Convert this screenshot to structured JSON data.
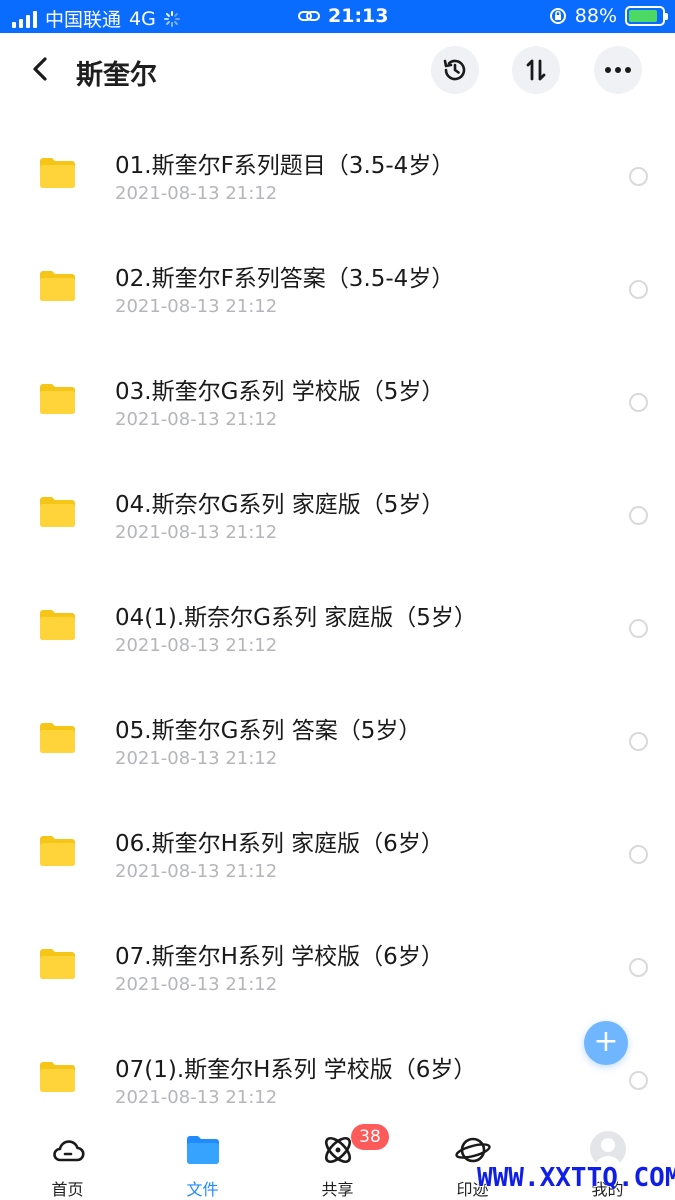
{
  "status_bar": {
    "carrier": "中国联通",
    "network": "4G",
    "time": "21:13",
    "battery": "88%",
    "battery_level": 0.88
  },
  "header": {
    "title": "斯奎尔",
    "icons": [
      "back-icon",
      "history-icon",
      "sort-icon",
      "more-icon"
    ]
  },
  "files": [
    {
      "name": "01.斯奎尔F系列题目（3.5-4岁）",
      "date": "2021-08-13 21:12"
    },
    {
      "name": "02.斯奎尔F系列答案（3.5-4岁）",
      "date": "2021-08-13 21:12"
    },
    {
      "name": "03.斯奎尔G系列 学校版（5岁）",
      "date": "2021-08-13 21:12"
    },
    {
      "name": "04.斯奈尔G系列 家庭版（5岁）",
      "date": "2021-08-13 21:12"
    },
    {
      "name": "04(1).斯奈尔G系列 家庭版（5岁）",
      "date": "2021-08-13 21:12"
    },
    {
      "name": "05.斯奎尔G系列 答案（5岁）",
      "date": "2021-08-13 21:12"
    },
    {
      "name": "06.斯奎尔H系列 家庭版（6岁）",
      "date": "2021-08-13 21:12"
    },
    {
      "name": "07.斯奎尔H系列 学校版（6岁）",
      "date": "2021-08-13 21:12"
    },
    {
      "name": "07(1).斯奎尔H系列 学校版（6岁）",
      "date": "2021-08-13 21:12"
    }
  ],
  "fab": {
    "label": "+"
  },
  "bottom_nav": {
    "items": [
      {
        "label": "首页",
        "icon": "cloud-icon",
        "active": false
      },
      {
        "label": "文件",
        "icon": "folder-icon",
        "active": true
      },
      {
        "label": "共享",
        "icon": "share-atom-icon",
        "active": false
      },
      {
        "label": "印迹",
        "icon": "planet-icon",
        "active": false
      },
      {
        "label": "我的",
        "icon": "avatar-icon",
        "active": false
      }
    ],
    "share_badge": "38"
  },
  "watermark": "WWW.XXTTQ.COM",
  "colors": {
    "status_bar": "#0a6bff",
    "folder": "#ffd43b",
    "accent": "#1f8bff",
    "badge": "#ff5a5a",
    "fab": "#6fb6ff"
  }
}
